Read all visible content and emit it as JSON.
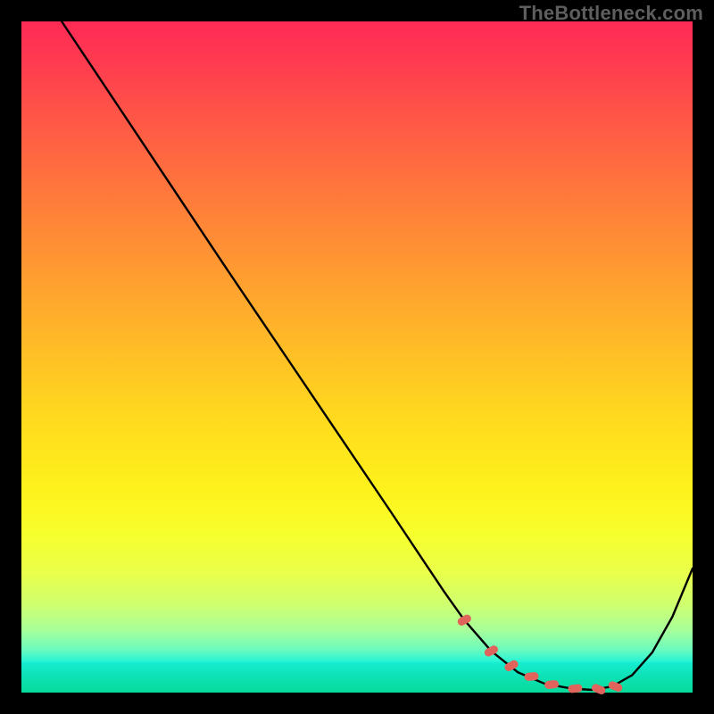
{
  "watermark": "TheBottleneck.com",
  "chart_data": {
    "type": "line",
    "title": "",
    "xlabel": "",
    "ylabel": "",
    "xlim": [
      0,
      100
    ],
    "ylim": [
      0,
      100
    ],
    "grid": false,
    "series": [
      {
        "name": "bottleneck-curve",
        "x": [
          6,
          10,
          15,
          20,
          25,
          30,
          35,
          40,
          45,
          50,
          55,
          60,
          63,
          66,
          70,
          74,
          78,
          82,
          85,
          88,
          91,
          94,
          97,
          100
        ],
        "values": [
          100,
          94,
          86.5,
          79,
          71.5,
          64,
          56.6,
          49.2,
          41.8,
          34.4,
          27,
          19.5,
          15,
          10.8,
          6.2,
          3.0,
          1.3,
          0.6,
          0.4,
          0.9,
          2.6,
          6.0,
          11.3,
          18.5
        ]
      }
    ],
    "markers": {
      "name": "optimal-range",
      "shape": "rounded-dot",
      "color": "#e0645c",
      "points_x": [
        66,
        70,
        73,
        76,
        79,
        82.5,
        86,
        88.5
      ],
      "points_y": [
        10.8,
        6.2,
        4.0,
        2.4,
        1.2,
        0.6,
        0.5,
        0.9
      ]
    },
    "background": {
      "type": "vertical-gradient",
      "stops": [
        {
          "pos": 0.0,
          "color": "#ff2a55"
        },
        {
          "pos": 0.5,
          "color": "#ffc524"
        },
        {
          "pos": 0.8,
          "color": "#f7ff2d"
        },
        {
          "pos": 0.96,
          "color": "#23f3d7"
        },
        {
          "pos": 1.0,
          "color": "#07da9a"
        }
      ]
    }
  }
}
